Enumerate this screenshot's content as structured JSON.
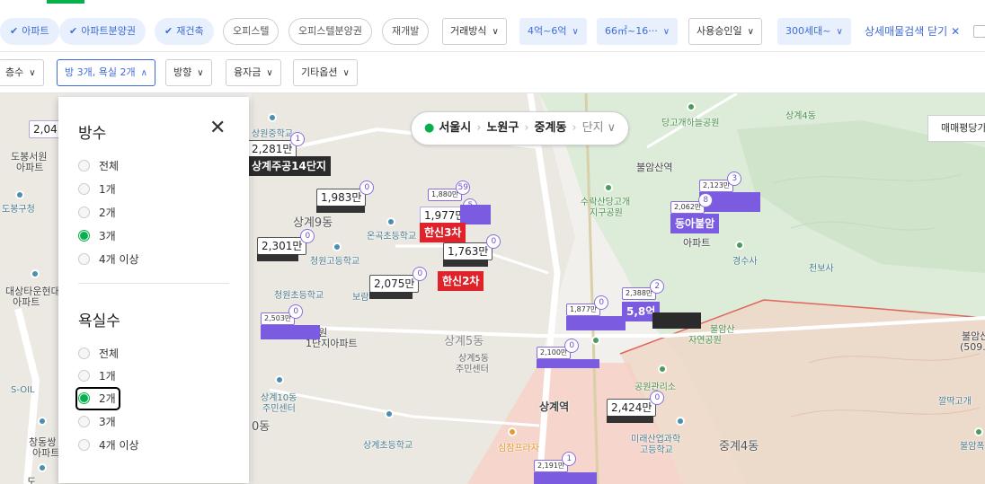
{
  "filters_row1": {
    "chips": [
      {
        "label": "아파트",
        "selected": true
      },
      {
        "label": "아파트분양권",
        "selected": true
      },
      {
        "label": "재건축",
        "selected": true
      },
      {
        "label": "오피스텔",
        "selected": false
      },
      {
        "label": "오피스텔분양권",
        "selected": false
      },
      {
        "label": "재개발",
        "selected": false
      }
    ],
    "dropdowns": [
      {
        "label": "거래방식",
        "selected": false
      },
      {
        "label": "4억~6억",
        "selected": true
      },
      {
        "label": "66㎡~16···",
        "selected": true
      },
      {
        "label": "사용승인일",
        "selected": false
      },
      {
        "label": "300세대~",
        "selected": true
      }
    ],
    "close_advanced": "상세매물검색 닫기"
  },
  "filters_row2": [
    {
      "label": "층수",
      "selected": false
    },
    {
      "label": "방 3개, 욕실 2개",
      "selected": true
    },
    {
      "label": "방향",
      "selected": false
    },
    {
      "label": "융자금",
      "selected": false
    },
    {
      "label": "기타옵션",
      "selected": false
    }
  ],
  "location": {
    "city": "서울시",
    "district": "노원구",
    "dong": "중계동",
    "complex": "단지"
  },
  "map_button": "매매평당가",
  "panel": {
    "rooms_title": "방수",
    "rooms": [
      "전체",
      "1개",
      "2개",
      "3개",
      "4개 이상"
    ],
    "rooms_selected": "3개",
    "baths_title": "욕실수",
    "baths": [
      "전체",
      "1개",
      "2개",
      "3개",
      "4개 이상"
    ],
    "baths_selected": "2개"
  },
  "map": {
    "places": [
      "상계주공14단지",
      "도봉서원",
      "아파트",
      "도봉구청",
      "대상타운현대",
      "아파트",
      "S-OIL",
      "창동쌍",
      "아파트",
      "도",
      "상원중학교",
      "상계9동",
      "온곡초등학교",
      "청원고등학교",
      "청원초등학교",
      "보람",
      "노원",
      "1단지아파트",
      "상계10동",
      "주민센터",
      "0동",
      "상계초등학교",
      "상계5동",
      "상계5동",
      "주민센터",
      "상계역",
      "심잠프라자",
      "수락산당고개",
      "지구공원",
      "당고개하늘공원",
      "불암산역",
      "상계4동",
      "동아불암",
      "아파트",
      "경수사",
      "천보사",
      "불암산",
      "자연공원",
      "공원관리소",
      "미래산업과학",
      "고등학교",
      "중계4동",
      "깔딱고개",
      "불암산",
      "(509.6",
      "불암폭"
    ],
    "price_pins": [
      {
        "price": "2,04",
        "count": ""
      },
      {
        "price": "2,281만",
        "count": "1"
      },
      {
        "price": "1,983만",
        "count": "0"
      },
      {
        "price": "1,880만",
        "count": "59"
      },
      {
        "price": "1,977만",
        "count": "5"
      },
      {
        "price": "2,301만",
        "count": "0"
      },
      {
        "price": "1,763만",
        "count": "0"
      },
      {
        "price": "2,075만",
        "count": "0"
      },
      {
        "price": "2,503만",
        "count": "0"
      },
      {
        "price": "2,123만",
        "count": "3"
      },
      {
        "price": "2,062만",
        "count": "8"
      },
      {
        "price": "1,877만",
        "count": "0"
      },
      {
        "price": "2,388만",
        "count": "2"
      },
      {
        "price": "2,100만",
        "count": "0"
      },
      {
        "price": "2,424만",
        "count": "0"
      },
      {
        "price": "2,191만",
        "count": "1"
      }
    ],
    "listing_labels": [
      "한신3차",
      "한신2차",
      "동아불암",
      "5,8억"
    ]
  }
}
